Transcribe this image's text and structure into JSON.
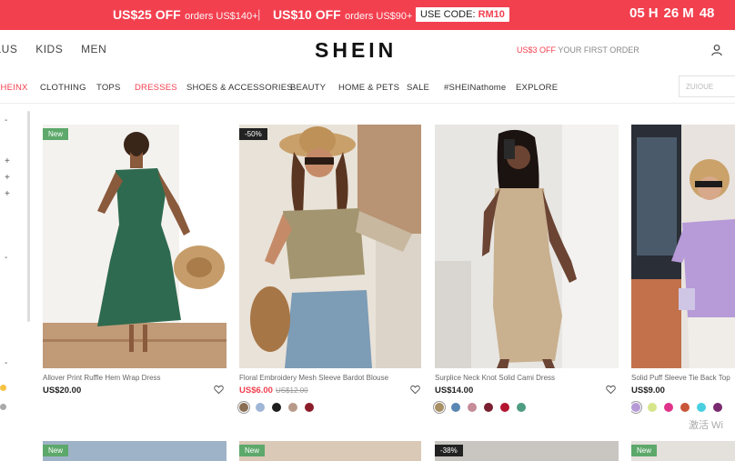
{
  "promo": {
    "offer1_amount": "US$25 OFF",
    "offer1_cond": "orders US$140+",
    "separator": "|",
    "offer2_amount": "US$10 OFF",
    "offer2_cond": "orders US$90+",
    "code_label": "USE CODE:",
    "code_value": "RM10",
    "timer": {
      "hours": "05",
      "h_unit": "H",
      "minutes": "26",
      "m_unit": "M",
      "seconds": "48"
    }
  },
  "header": {
    "nav": [
      "PLUS",
      "KIDS",
      "MEN"
    ],
    "logo": "SHEIN",
    "offer_amount": "US$3 OFF",
    "offer_text": "YOUR FIRST ORDER"
  },
  "catnav": {
    "items": [
      "SHEINX",
      "CLOTHING",
      "TOPS",
      "DRESSES",
      "SHOES & ACCESSORIES",
      "BEAUTY",
      "HOME & PETS",
      "SALE",
      "#SHEINathome",
      "EXPLORE"
    ],
    "active": "DRESSES",
    "search_placeholder": "ZUIOUE"
  },
  "filters": {
    "marks": [
      "-",
      "+",
      "+",
      "+",
      "-",
      "-"
    ],
    "colors": [
      "#f5c242",
      "#aaaaaa"
    ]
  },
  "products": [
    {
      "badge": "New",
      "title": "Allover Print Ruffle Hem Wrap Dress",
      "price": "US$20.00",
      "old_price": "",
      "swatches": []
    },
    {
      "badge": "-50%",
      "title": "Floral Embroidery Mesh Sleeve Bardot Blouse",
      "price": "US$6.00",
      "old_price": "US$12.00",
      "swatches": [
        "#8a6f55",
        "#9fb6d6",
        "#1e1e1e",
        "#b89a8a",
        "#8c1c2a"
      ]
    },
    {
      "badge": "",
      "title": "Surplice Neck Knot Solid Cami Dress",
      "price": "US$14.00",
      "old_price": "",
      "swatches": [
        "#a88f64",
        "#5a86b3",
        "#c48b98",
        "#7a2030",
        "#b3142f",
        "#4e9c83"
      ]
    },
    {
      "badge": "",
      "title": "Solid Puff Sleeve Tie Back Top",
      "price": "US$9.00",
      "old_price": "",
      "swatches": [
        "#b69ad6",
        "#d6e58a",
        "#e0338a",
        "#c9563a",
        "#48cfe0",
        "#7a2a6e"
      ]
    }
  ],
  "bottom_badges": [
    "New",
    "New",
    "-38%",
    "New"
  ],
  "watermark": "激活 Wi"
}
